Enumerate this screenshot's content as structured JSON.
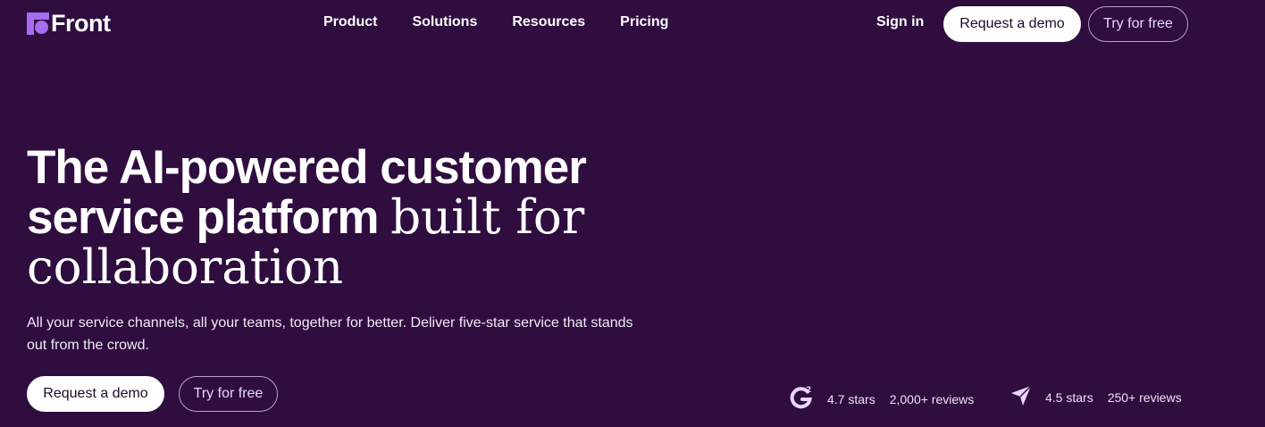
{
  "brand": {
    "name": "Front",
    "accent": "#a66cf1"
  },
  "nav": {
    "links": [
      "Product",
      "Solutions",
      "Resources",
      "Pricing"
    ],
    "sign_in": "Sign in",
    "request_demo": "Request a demo",
    "try_free": "Try for free"
  },
  "hero": {
    "title_sans": "The AI-powered customer service platform",
    "title_serif_1": "built for",
    "title_serif_2": "collaboration",
    "subtitle": "All your service channels, all your teams, together for better. Deliver five-star service that stands out from the crowd.",
    "cta_primary": "Request a demo",
    "cta_secondary": "Try for free"
  },
  "ratings": [
    {
      "icon": "g2-icon",
      "stars": "4.7 stars",
      "reviews": "2,000+ reviews"
    },
    {
      "icon": "capterra-icon",
      "stars": "4.5 stars",
      "reviews": "250+ reviews"
    }
  ],
  "colors": {
    "background": "#2f0d3f",
    "text": "#ffffff",
    "outline": "#b8a3cc"
  }
}
